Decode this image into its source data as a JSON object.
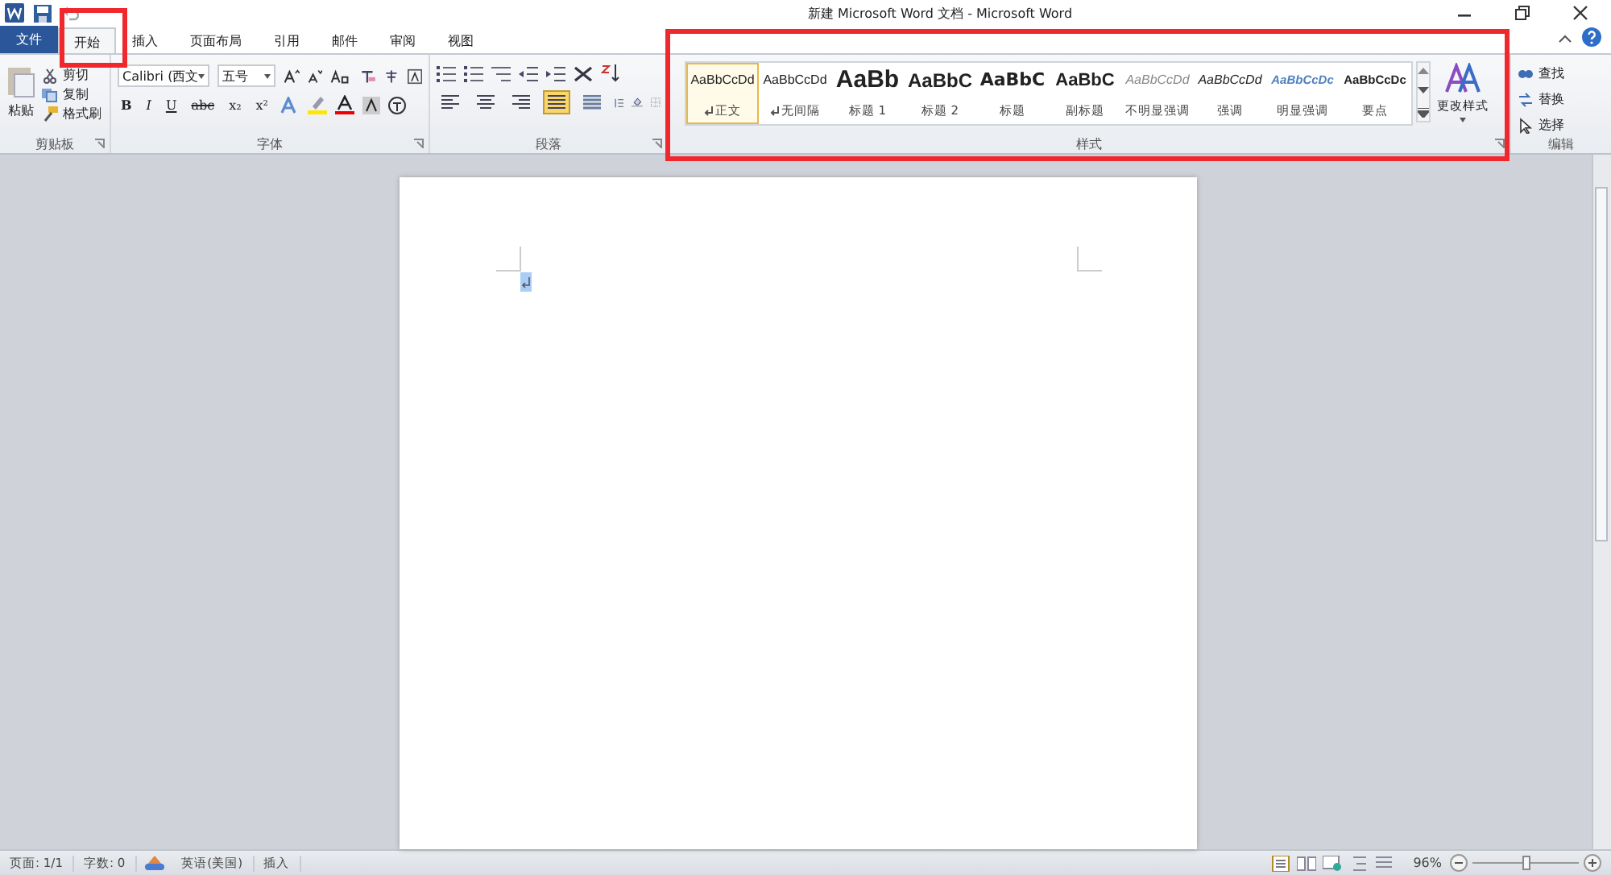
{
  "window": {
    "title": "新建 Microsoft Word 文档 - Microsoft Word"
  },
  "tabs": [
    {
      "label": "文件",
      "kind": "file",
      "selected": false
    },
    {
      "label": "开始",
      "kind": "tab",
      "selected": true
    },
    {
      "label": "插入",
      "kind": "tab",
      "selected": false
    },
    {
      "label": "页面布局",
      "kind": "tab",
      "selected": false
    },
    {
      "label": "引用",
      "kind": "tab",
      "selected": false
    },
    {
      "label": "邮件",
      "kind": "tab",
      "selected": false
    },
    {
      "label": "审阅",
      "kind": "tab",
      "selected": false
    },
    {
      "label": "视图",
      "kind": "tab",
      "selected": false
    }
  ],
  "clipboard": {
    "paste": "粘贴",
    "items": [
      {
        "label": "剪切",
        "kind": "cut"
      },
      {
        "label": "复制",
        "kind": "copy"
      },
      {
        "label": "格式刷",
        "kind": "brush"
      }
    ],
    "group": "剪贴板"
  },
  "font": {
    "name": "Calibri (西文",
    "size": "五号",
    "format_buttons": [
      "B",
      "I",
      "U",
      "abc",
      "x₂",
      "x²"
    ],
    "group": "字体"
  },
  "paragraph": {
    "group": "段落",
    "align": [
      {
        "kind": "left",
        "selected": false
      },
      {
        "kind": "center",
        "selected": false
      },
      {
        "kind": "right",
        "selected": false
      },
      {
        "kind": "justify",
        "selected": true
      },
      {
        "kind": "distributed",
        "selected": false
      }
    ]
  },
  "styles": {
    "group": "样式",
    "items": [
      {
        "preview": "AaBbCcDd",
        "label": "正文",
        "kind": "normal",
        "paragraph_mark": true,
        "selected": true
      },
      {
        "preview": "AaBbCcDd",
        "label": "无间隔",
        "kind": "normal",
        "paragraph_mark": true,
        "selected": false
      },
      {
        "preview": "AaBb",
        "label": "标题 1",
        "kind": "h1",
        "paragraph_mark": false,
        "selected": false
      },
      {
        "preview": "AaBbC",
        "label": "标题 2",
        "kind": "h2",
        "paragraph_mark": false,
        "selected": false
      },
      {
        "preview": "AaBbC",
        "label": "标题",
        "kind": "title",
        "paragraph_mark": false,
        "selected": false
      },
      {
        "preview": "AaBbC",
        "label": "副标题",
        "kind": "subtitle",
        "paragraph_mark": false,
        "selected": false
      },
      {
        "preview": "AaBbCcDd",
        "label": "不明显强调",
        "kind": "subtle",
        "paragraph_mark": false,
        "selected": false
      },
      {
        "preview": "AaBbCcDd",
        "label": "强调",
        "kind": "emphasis",
        "paragraph_mark": false,
        "selected": false
      },
      {
        "preview": "AaBbCcDc",
        "label": "明显强调",
        "kind": "intense",
        "paragraph_mark": false,
        "selected": false
      },
      {
        "preview": "AaBbCcDc",
        "label": "要点",
        "kind": "strong",
        "paragraph_mark": false,
        "selected": false
      }
    ],
    "change": "更改样式"
  },
  "editing": {
    "group": "编辑",
    "items": [
      {
        "label": "查找",
        "kind": "find"
      },
      {
        "label": "替换",
        "kind": "replace"
      },
      {
        "label": "选择",
        "kind": "select"
      }
    ]
  },
  "status_bar": {
    "page": "页面: 1/1",
    "words": "字数: 0",
    "language": "英语(美国)",
    "mode": "插入",
    "zoom": "96%",
    "zoom_level": {
      "level": 0.52
    }
  }
}
